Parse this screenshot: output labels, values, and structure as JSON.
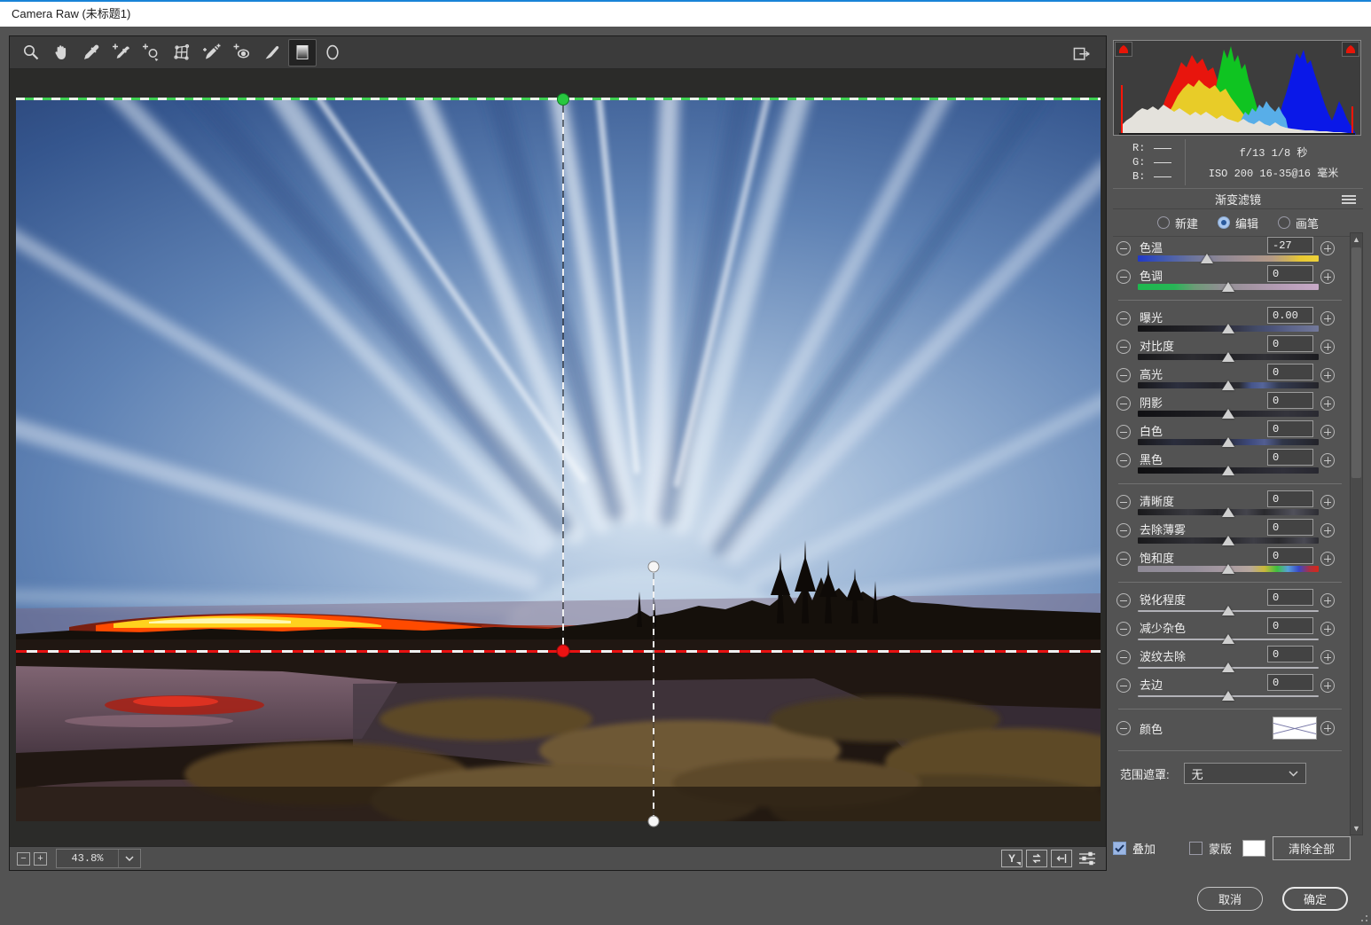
{
  "window": {
    "title": "Camera Raw (未标题1)"
  },
  "colors": {
    "accent_blue": "#1883d7",
    "panel_bg": "#535353",
    "canvas_bg": "#2b2b29",
    "filter_start_dot": "#28c840",
    "filter_end_dot": "#ec1212",
    "selected_radio_fill": "#a9c7ee",
    "checkbox_checked": "#9ab6e4"
  },
  "toolbar": {
    "tools": [
      "zoom-tool",
      "hand-tool",
      "white-balance-tool",
      "color-sampler-tool",
      "targeted-adjustment-tool",
      "transform-tool",
      "spot-removal-tool",
      "red-eye-tool",
      "adjustment-brush-tool",
      "graduated-filter-tool",
      "radial-filter-tool"
    ],
    "selected_tool": "graduated-filter-tool"
  },
  "histogram": {
    "r_label": "R:",
    "g_label": "G:",
    "b_label": "B:",
    "r_value": "",
    "g_value": "",
    "b_value": "",
    "exif_line1": "f/13  1/8 秒",
    "exif_line2": "ISO 200  16-35@16 毫米"
  },
  "chart_data": {
    "type": "area",
    "title": "RGB histogram",
    "series": [
      {
        "name": "red",
        "peak_x_pct": 30,
        "peak_h_pct": 83,
        "range_pct": [
          11,
          55
        ]
      },
      {
        "name": "yellow",
        "peak_x_pct": 31,
        "peak_h_pct": 53,
        "range_pct": [
          17,
          55
        ]
      },
      {
        "name": "green",
        "peak_x_pct": 45,
        "peak_h_pct": 90,
        "range_pct": [
          37,
          60
        ]
      },
      {
        "name": "cyan",
        "peak_x_pct": 55,
        "peak_h_pct": 30,
        "range_pct": [
          50,
          71
        ]
      },
      {
        "name": "blue",
        "peak_x_pct": 76,
        "peak_h_pct": 87,
        "range_pct": [
          65,
          98
        ]
      },
      {
        "name": "gray",
        "peak_x_pct": 14,
        "peak_h_pct": 30,
        "range_pct": [
          3,
          97
        ]
      }
    ],
    "clipping": {
      "shadows": true,
      "highlights": true
    }
  },
  "panel": {
    "title": "渐变滤镜",
    "modes": [
      {
        "label": "新建",
        "selected": false
      },
      {
        "label": "编辑",
        "selected": true
      },
      {
        "label": "画笔",
        "selected": false
      }
    ],
    "sliders": [
      {
        "label": "色温",
        "value": "-27",
        "track": "temp",
        "thumb": 38,
        "sep_after": false
      },
      {
        "label": "色调",
        "value": "0",
        "track": "tint",
        "thumb": 50,
        "sep_after": true
      },
      {
        "label": "曝光",
        "value": "0.00",
        "track": "exposure",
        "thumb": 50,
        "sep_after": false
      },
      {
        "label": "对比度",
        "value": "0",
        "track": "contrast",
        "thumb": 50,
        "sep_after": false
      },
      {
        "label": "高光",
        "value": "0",
        "track": "highlights",
        "thumb": 50,
        "sep_after": false
      },
      {
        "label": "阴影",
        "value": "0",
        "track": "shadows",
        "thumb": 50,
        "sep_after": false
      },
      {
        "label": "白色",
        "value": "0",
        "track": "whites",
        "thumb": 50,
        "sep_after": false
      },
      {
        "label": "黑色",
        "value": "0",
        "track": "blacks",
        "thumb": 50,
        "sep_after": true
      },
      {
        "label": "清晰度",
        "value": "0",
        "track": "clarity",
        "thumb": 50,
        "sep_after": false
      },
      {
        "label": "去除薄雾",
        "value": "0",
        "track": "dehaze",
        "thumb": 50,
        "sep_after": false
      },
      {
        "label": "饱和度",
        "value": "0",
        "track": "saturation",
        "thumb": 50,
        "sep_after": true
      },
      {
        "label": "锐化程度",
        "value": "0",
        "track": "plain",
        "thumb": 50,
        "sep_after": false
      },
      {
        "label": "减少杂色",
        "value": "0",
        "track": "plain",
        "thumb": 50,
        "sep_after": false
      },
      {
        "label": "波纹去除",
        "value": "0",
        "track": "plain",
        "thumb": 50,
        "sep_after": false
      },
      {
        "label": "去边",
        "value": "0",
        "track": "plain",
        "thumb": 50,
        "sep_after": true
      }
    ],
    "color_row": {
      "label": "颜色",
      "swatch": "none-x"
    },
    "range_mask": {
      "label": "范围遮罩:",
      "value": "无"
    },
    "footer": {
      "overlay_label": "叠加",
      "overlay_checked": true,
      "mask_label": "蒙版",
      "mask_checked": false,
      "clear_all_label": "清除全部"
    }
  },
  "statusbar": {
    "zoom_level": "43.8%",
    "preview_label": "Y",
    "icons": [
      "preview-toggle-icon",
      "swap-views-icon",
      "copy-settings-icon",
      "preview-preferences-icon"
    ]
  },
  "dialog_buttons": {
    "cancel": "取消",
    "ok": "确定"
  }
}
